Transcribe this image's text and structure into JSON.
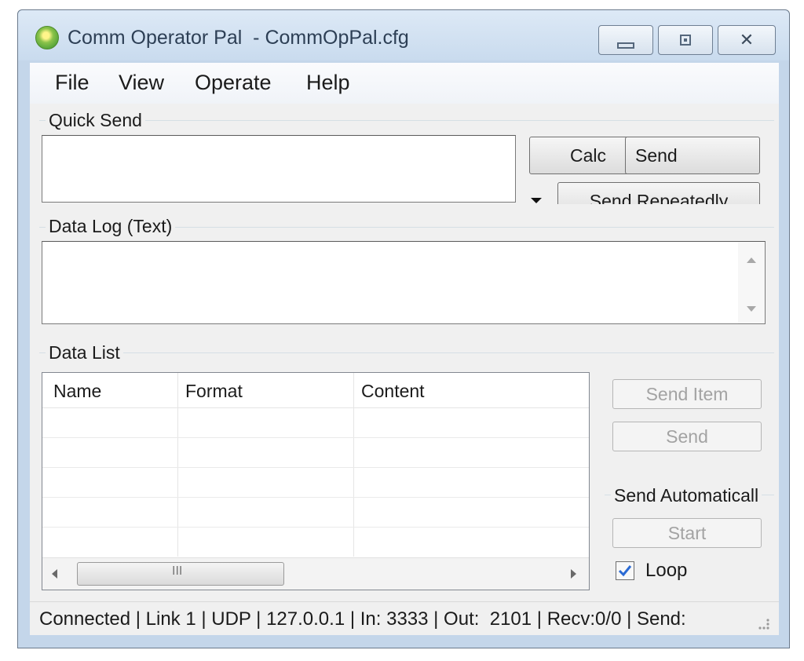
{
  "window": {
    "title": "Comm Operator Pal  - CommOpPal.cfg",
    "app_icon": "app-logo-icon",
    "buttons": {
      "minimize": "minimize-icon",
      "maximize": "maximize-icon",
      "close": "close-icon"
    },
    "close_glyph": "✕"
  },
  "menu": {
    "items": [
      "File",
      "View",
      "Operate",
      "Help"
    ]
  },
  "quick_send": {
    "label": "Quick Send",
    "input_value": "",
    "calc_label": "Calc",
    "send_label": "Send",
    "send_repeatedly_label": "Send Repeatedly"
  },
  "data_log": {
    "label": "Data Log (Text)",
    "content": ""
  },
  "data_list": {
    "label": "Data List",
    "columns": [
      "Name",
      "Format",
      "Content"
    ],
    "rows": [],
    "hscroll_mark": "III",
    "send_item_label": "Send Item",
    "send_label": "Send",
    "send_automatically_label": "Send Automaticall",
    "start_label": "Start",
    "loop_label": "Loop",
    "loop_checked": true
  },
  "status_bar": {
    "text": "Connected | Link 1 | UDP | 127.0.0.1 | In: 3333 | Out:  2101 | Recv:0/0 | Send:"
  },
  "colors": {
    "title_bar": "#c9dbee",
    "client": "#f0f0f0",
    "check": "#2a6ad4"
  }
}
